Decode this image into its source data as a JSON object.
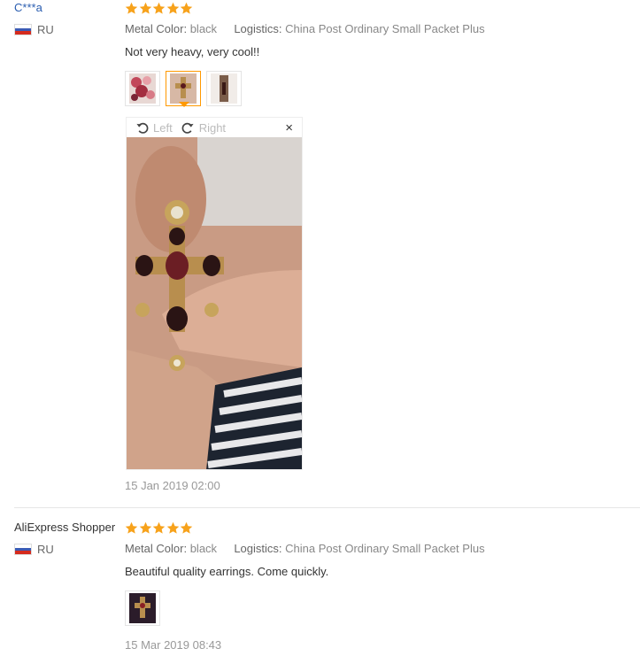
{
  "reviews": [
    {
      "user": "C***a",
      "country": "RU",
      "rating": 5,
      "attrs": {
        "color_key": "Metal Color:",
        "color_val": "black",
        "logistics_key": "Logistics:",
        "logistics_val": "China Post Ordinary Small Packet Plus"
      },
      "content": "Not very heavy, very cool!!",
      "viewer": {
        "rotate_left": "Left",
        "rotate_right": "Right",
        "close": "×"
      },
      "date": "15 Jan 2019 02:00"
    },
    {
      "user": "AliExpress Shopper",
      "country": "RU",
      "rating": 5,
      "attrs": {
        "color_key": "Metal Color:",
        "color_val": "black",
        "logistics_key": "Logistics:",
        "logistics_val": "China Post Ordinary Small Packet Plus"
      },
      "content": "Beautiful quality earrings. Come quickly.",
      "date": "15 Mar 2019 08:43"
    }
  ],
  "colors": {
    "star": "#f7a21b",
    "link": "#2a5db0",
    "active_thumb": "#ff9900"
  },
  "icons": [
    "star-icon",
    "russia-flag-icon",
    "rotate-left-icon",
    "rotate-right-icon",
    "close-icon"
  ]
}
